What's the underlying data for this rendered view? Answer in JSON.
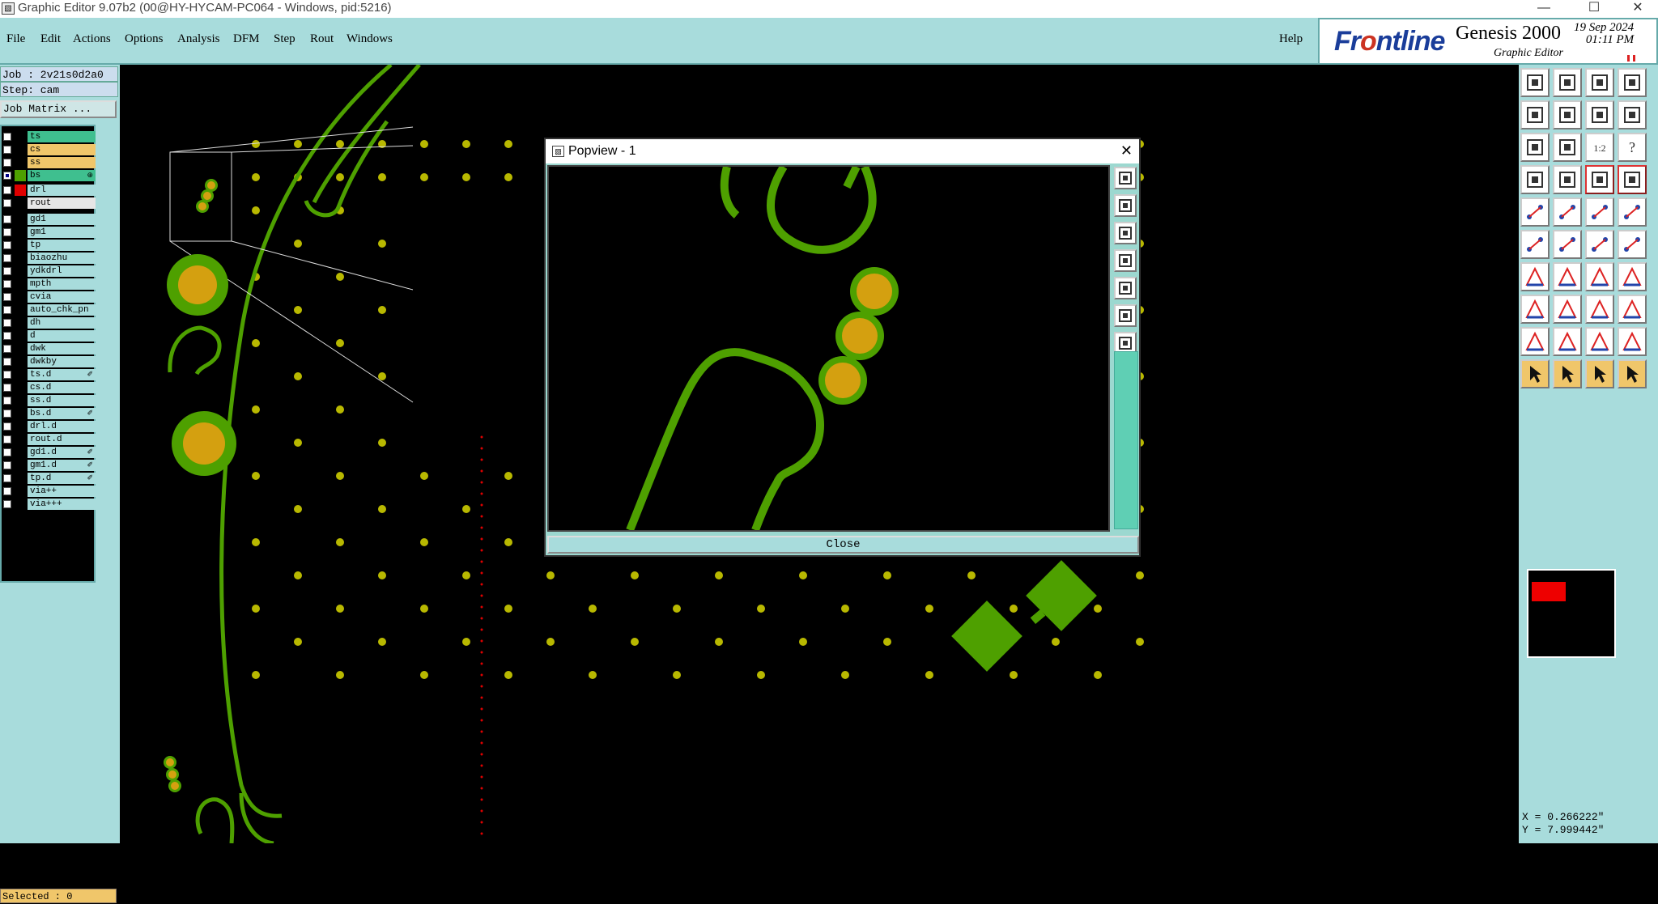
{
  "window": {
    "title": "Graphic Editor 9.07b2 (00@HY-HYCAM-PC064 - Windows, pid:5216)",
    "controls": [
      "—",
      "☐",
      "✕"
    ]
  },
  "menu": {
    "items": [
      {
        "label": "File"
      },
      {
        "label": "Edit"
      },
      {
        "label": "Actions"
      },
      {
        "label": "Options"
      },
      {
        "label": "Analysis"
      },
      {
        "label": "DFM"
      },
      {
        "label": "Step"
      },
      {
        "label": "Rout"
      },
      {
        "label": "Windows"
      }
    ],
    "help": "Help"
  },
  "brand": {
    "logo_pre": "Fr",
    "logo_mid": "o",
    "logo_post": "ntline",
    "product": "Genesis 2000",
    "subtitle": "Graphic Editor",
    "date": "19  Sep  2024",
    "time": "01:11  PM"
  },
  "job": {
    "job_label": "Job : 2v21s0d2a0",
    "step_label": "Step: cam",
    "matrix_button": "Job Matrix ..."
  },
  "layers": [
    {
      "name": "ts",
      "color": "#3fbf8f",
      "checked": false
    },
    {
      "name": "cs",
      "color": "#f0c66a",
      "checked": false
    },
    {
      "name": "ss",
      "color": "#f0c66a",
      "checked": false
    },
    {
      "name": "bs",
      "color": "#3fbf8f",
      "checked": true,
      "swatch": "#4ea000",
      "edit": "⊕"
    },
    {
      "name": "drl",
      "color": "#a8dcdc",
      "checked": false,
      "swatch": "#e00000"
    },
    {
      "name": "rout",
      "color": "#e6e6e6",
      "checked": false
    },
    {
      "name": "gd1",
      "checked": false
    },
    {
      "name": "gm1",
      "checked": false
    },
    {
      "name": "tp",
      "checked": false
    },
    {
      "name": "biaozhu",
      "checked": false
    },
    {
      "name": "ydkdrl",
      "checked": false
    },
    {
      "name": "mpth",
      "checked": false
    },
    {
      "name": "cvia",
      "checked": false
    },
    {
      "name": "auto_chk_pn",
      "checked": false
    },
    {
      "name": "dh",
      "checked": false
    },
    {
      "name": "d",
      "checked": false
    },
    {
      "name": "dwk",
      "checked": false
    },
    {
      "name": "dwkby",
      "checked": false
    },
    {
      "name": "ts.d",
      "checked": false,
      "edit": "✐"
    },
    {
      "name": "cs.d",
      "checked": false
    },
    {
      "name": "ss.d",
      "checked": false
    },
    {
      "name": "bs.d",
      "checked": false,
      "edit": "✐"
    },
    {
      "name": "drl.d",
      "checked": false
    },
    {
      "name": "rout.d",
      "checked": false
    },
    {
      "name": "gd1.d",
      "checked": false,
      "edit": "✐"
    },
    {
      "name": "gm1.d",
      "checked": false,
      "edit": "✐"
    },
    {
      "name": "tp.d",
      "checked": false,
      "edit": "✐"
    },
    {
      "name": "via++",
      "checked": false
    },
    {
      "name": "via+++",
      "checked": false
    }
  ],
  "status": {
    "selected": "Selected : 0"
  },
  "coords": {
    "x": "X = 0.266222\"",
    "y": "Y = 7.999442\""
  },
  "popview": {
    "title": "Popview - 1",
    "close_x": "✕",
    "close_button": "Close"
  },
  "colors": {
    "ui_teal": "#a8dcdc",
    "copper_green": "#4ea000",
    "pad_gold": "#d4a010",
    "via_yellow": "#b8b800",
    "drill_red": "#e00000"
  }
}
